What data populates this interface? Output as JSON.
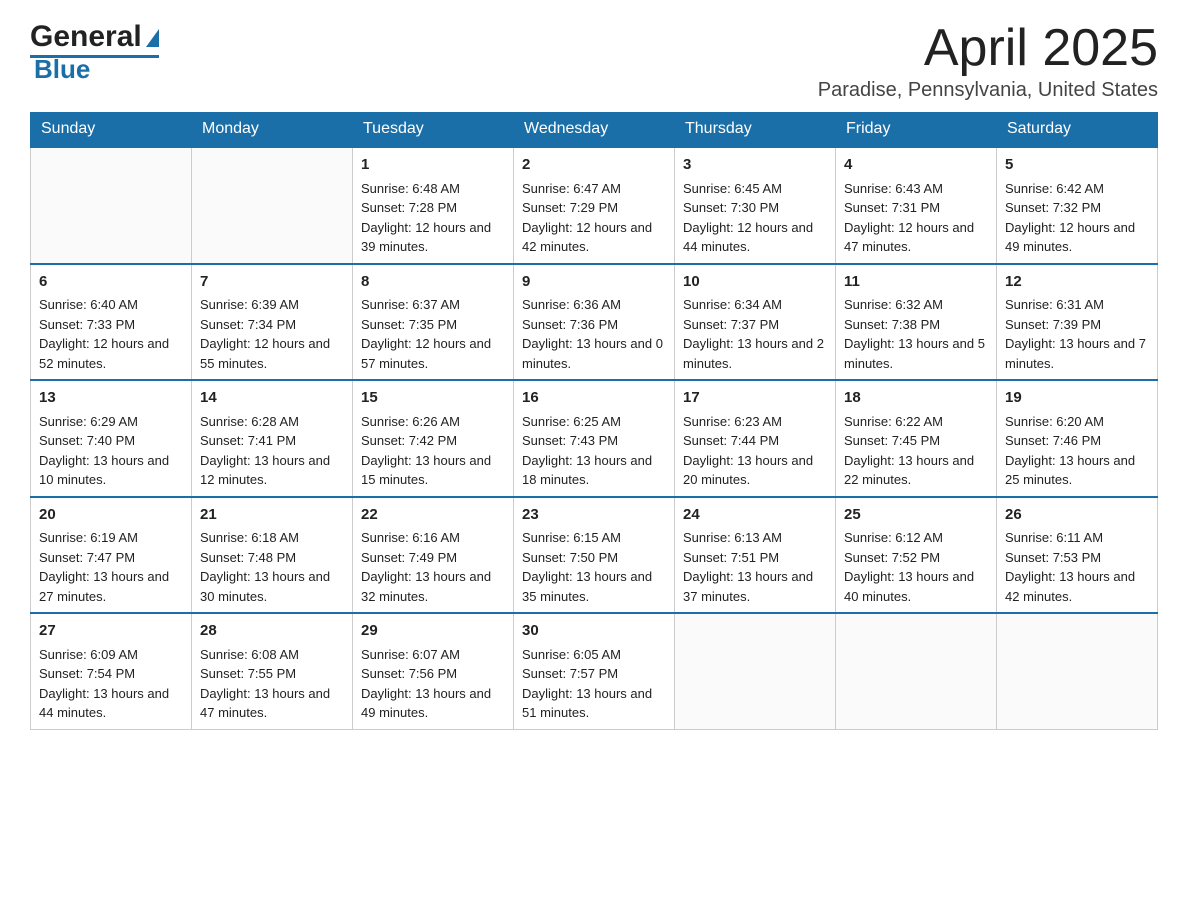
{
  "header": {
    "month_title": "April 2025",
    "location": "Paradise, Pennsylvania, United States",
    "logo_general": "General",
    "logo_blue": "Blue"
  },
  "weekdays": [
    "Sunday",
    "Monday",
    "Tuesday",
    "Wednesday",
    "Thursday",
    "Friday",
    "Saturday"
  ],
  "weeks": [
    [
      {
        "day": "",
        "sunrise": "",
        "sunset": "",
        "daylight": ""
      },
      {
        "day": "",
        "sunrise": "",
        "sunset": "",
        "daylight": ""
      },
      {
        "day": "1",
        "sunrise": "Sunrise: 6:48 AM",
        "sunset": "Sunset: 7:28 PM",
        "daylight": "Daylight: 12 hours and 39 minutes."
      },
      {
        "day": "2",
        "sunrise": "Sunrise: 6:47 AM",
        "sunset": "Sunset: 7:29 PM",
        "daylight": "Daylight: 12 hours and 42 minutes."
      },
      {
        "day": "3",
        "sunrise": "Sunrise: 6:45 AM",
        "sunset": "Sunset: 7:30 PM",
        "daylight": "Daylight: 12 hours and 44 minutes."
      },
      {
        "day": "4",
        "sunrise": "Sunrise: 6:43 AM",
        "sunset": "Sunset: 7:31 PM",
        "daylight": "Daylight: 12 hours and 47 minutes."
      },
      {
        "day": "5",
        "sunrise": "Sunrise: 6:42 AM",
        "sunset": "Sunset: 7:32 PM",
        "daylight": "Daylight: 12 hours and 49 minutes."
      }
    ],
    [
      {
        "day": "6",
        "sunrise": "Sunrise: 6:40 AM",
        "sunset": "Sunset: 7:33 PM",
        "daylight": "Daylight: 12 hours and 52 minutes."
      },
      {
        "day": "7",
        "sunrise": "Sunrise: 6:39 AM",
        "sunset": "Sunset: 7:34 PM",
        "daylight": "Daylight: 12 hours and 55 minutes."
      },
      {
        "day": "8",
        "sunrise": "Sunrise: 6:37 AM",
        "sunset": "Sunset: 7:35 PM",
        "daylight": "Daylight: 12 hours and 57 minutes."
      },
      {
        "day": "9",
        "sunrise": "Sunrise: 6:36 AM",
        "sunset": "Sunset: 7:36 PM",
        "daylight": "Daylight: 13 hours and 0 minutes."
      },
      {
        "day": "10",
        "sunrise": "Sunrise: 6:34 AM",
        "sunset": "Sunset: 7:37 PM",
        "daylight": "Daylight: 13 hours and 2 minutes."
      },
      {
        "day": "11",
        "sunrise": "Sunrise: 6:32 AM",
        "sunset": "Sunset: 7:38 PM",
        "daylight": "Daylight: 13 hours and 5 minutes."
      },
      {
        "day": "12",
        "sunrise": "Sunrise: 6:31 AM",
        "sunset": "Sunset: 7:39 PM",
        "daylight": "Daylight: 13 hours and 7 minutes."
      }
    ],
    [
      {
        "day": "13",
        "sunrise": "Sunrise: 6:29 AM",
        "sunset": "Sunset: 7:40 PM",
        "daylight": "Daylight: 13 hours and 10 minutes."
      },
      {
        "day": "14",
        "sunrise": "Sunrise: 6:28 AM",
        "sunset": "Sunset: 7:41 PM",
        "daylight": "Daylight: 13 hours and 12 minutes."
      },
      {
        "day": "15",
        "sunrise": "Sunrise: 6:26 AM",
        "sunset": "Sunset: 7:42 PM",
        "daylight": "Daylight: 13 hours and 15 minutes."
      },
      {
        "day": "16",
        "sunrise": "Sunrise: 6:25 AM",
        "sunset": "Sunset: 7:43 PM",
        "daylight": "Daylight: 13 hours and 18 minutes."
      },
      {
        "day": "17",
        "sunrise": "Sunrise: 6:23 AM",
        "sunset": "Sunset: 7:44 PM",
        "daylight": "Daylight: 13 hours and 20 minutes."
      },
      {
        "day": "18",
        "sunrise": "Sunrise: 6:22 AM",
        "sunset": "Sunset: 7:45 PM",
        "daylight": "Daylight: 13 hours and 22 minutes."
      },
      {
        "day": "19",
        "sunrise": "Sunrise: 6:20 AM",
        "sunset": "Sunset: 7:46 PM",
        "daylight": "Daylight: 13 hours and 25 minutes."
      }
    ],
    [
      {
        "day": "20",
        "sunrise": "Sunrise: 6:19 AM",
        "sunset": "Sunset: 7:47 PM",
        "daylight": "Daylight: 13 hours and 27 minutes."
      },
      {
        "day": "21",
        "sunrise": "Sunrise: 6:18 AM",
        "sunset": "Sunset: 7:48 PM",
        "daylight": "Daylight: 13 hours and 30 minutes."
      },
      {
        "day": "22",
        "sunrise": "Sunrise: 6:16 AM",
        "sunset": "Sunset: 7:49 PM",
        "daylight": "Daylight: 13 hours and 32 minutes."
      },
      {
        "day": "23",
        "sunrise": "Sunrise: 6:15 AM",
        "sunset": "Sunset: 7:50 PM",
        "daylight": "Daylight: 13 hours and 35 minutes."
      },
      {
        "day": "24",
        "sunrise": "Sunrise: 6:13 AM",
        "sunset": "Sunset: 7:51 PM",
        "daylight": "Daylight: 13 hours and 37 minutes."
      },
      {
        "day": "25",
        "sunrise": "Sunrise: 6:12 AM",
        "sunset": "Sunset: 7:52 PM",
        "daylight": "Daylight: 13 hours and 40 minutes."
      },
      {
        "day": "26",
        "sunrise": "Sunrise: 6:11 AM",
        "sunset": "Sunset: 7:53 PM",
        "daylight": "Daylight: 13 hours and 42 minutes."
      }
    ],
    [
      {
        "day": "27",
        "sunrise": "Sunrise: 6:09 AM",
        "sunset": "Sunset: 7:54 PM",
        "daylight": "Daylight: 13 hours and 44 minutes."
      },
      {
        "day": "28",
        "sunrise": "Sunrise: 6:08 AM",
        "sunset": "Sunset: 7:55 PM",
        "daylight": "Daylight: 13 hours and 47 minutes."
      },
      {
        "day": "29",
        "sunrise": "Sunrise: 6:07 AM",
        "sunset": "Sunset: 7:56 PM",
        "daylight": "Daylight: 13 hours and 49 minutes."
      },
      {
        "day": "30",
        "sunrise": "Sunrise: 6:05 AM",
        "sunset": "Sunset: 7:57 PM",
        "daylight": "Daylight: 13 hours and 51 minutes."
      },
      {
        "day": "",
        "sunrise": "",
        "sunset": "",
        "daylight": ""
      },
      {
        "day": "",
        "sunrise": "",
        "sunset": "",
        "daylight": ""
      },
      {
        "day": "",
        "sunrise": "",
        "sunset": "",
        "daylight": ""
      }
    ]
  ]
}
